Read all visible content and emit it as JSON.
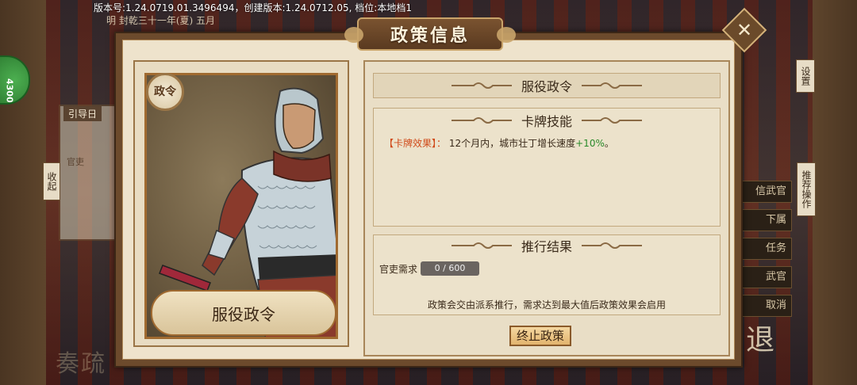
{
  "version_info": "版本号:1.24.0719.01.3496494，创建版本:1.24.0712.05, 档位:本地档1",
  "date": "明 封乾三十一年(夏) 五月",
  "green_badge": "4300",
  "background": {
    "guide_tab": "引导日",
    "official_label": "官吏",
    "collapse_btn": "收起",
    "settings_btn": "设置",
    "recommend_btn": "推荐操作",
    "side_buttons": [
      "信武官",
      "下属",
      "任务",
      "武官",
      "取消"
    ],
    "exit_btn": "退",
    "memorial_text": "奏疏"
  },
  "dialog": {
    "title": "政策信息",
    "card": {
      "badge": "政令",
      "name": "服役政令"
    },
    "policy_name": "服役政令",
    "skill_header": "卡牌技能",
    "skill_tag": "【卡牌效果】：",
    "skill_text": "12个月内，城市壮丁增长速度",
    "skill_value": "+10%",
    "skill_end": "。",
    "result_header": "推行结果",
    "requirement_label": "官吏需求",
    "requirement_value": "0 / 600",
    "requirement_progress": 0,
    "note": "政策会交由派系推行，需求达到最大值后政策效果会启用",
    "stop_button": "终止政策"
  },
  "colors": {
    "accent_red": "#d04a1a",
    "accent_green": "#2a8a2a",
    "frame_brown": "#6c4a2c"
  }
}
